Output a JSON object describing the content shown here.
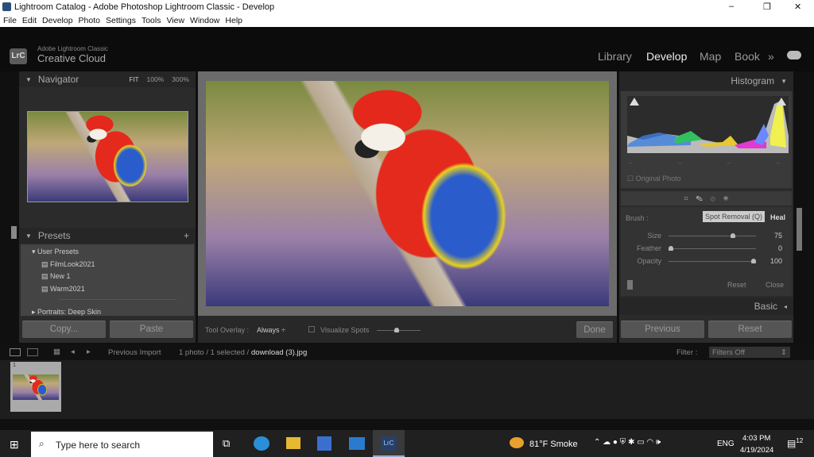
{
  "window": {
    "title": "Lightroom Catalog - Adobe Photoshop Lightroom Classic - Develop",
    "controls": [
      "–",
      "❐",
      "✕"
    ]
  },
  "menu": [
    "File",
    "Edit",
    "Develop",
    "Photo",
    "Settings",
    "Tools",
    "View",
    "Window",
    "Help"
  ],
  "brand": {
    "logo": "LrC",
    "sub": "Adobe Lightroom Classic",
    "name": "Creative Cloud"
  },
  "modules": {
    "items": [
      "Library",
      "Develop",
      "Map",
      "Book"
    ],
    "active": "Develop",
    "more": "»"
  },
  "navigator": {
    "title": "Navigator",
    "zoom": [
      "FIT",
      "100%",
      "300%"
    ]
  },
  "presets": {
    "title": "Presets",
    "add": "+",
    "group": "User Presets",
    "items": [
      "FilmLook2021",
      "New 1",
      "Warm2021"
    ],
    "next_group": "Portraits: Deep Skin"
  },
  "left_buttons": {
    "copy": "Copy...",
    "paste": "Paste"
  },
  "toolbar": {
    "overlay_label": "Tool Overlay :",
    "overlay_value": "Always",
    "visualize": "Visualize Spots",
    "visualize_checked": false,
    "done": "Done"
  },
  "histogram": {
    "title": "Histogram",
    "original_photo": "Original Photo"
  },
  "spot": {
    "brush_label": "Brush :",
    "modes": [
      "Spot Removal (Q)",
      "Heal"
    ],
    "sliders": [
      {
        "label": "Size",
        "value": "75",
        "fraction": 0.75
      },
      {
        "label": "Feather",
        "value": "0",
        "fraction": 0
      },
      {
        "label": "Opacity",
        "value": "100",
        "fraction": 1
      }
    ],
    "reset": "Reset",
    "close": "Close"
  },
  "basic": {
    "title": "Basic"
  },
  "right_buttons": {
    "previous": "Previous",
    "reset": "Reset"
  },
  "filmbar": {
    "source": "Previous Import",
    "count": "1 photo / 1 selected /",
    "file": "download (3).jpg",
    "filter_label": "Filter :",
    "filter_value": "Filters Off",
    "thumb_index": "1"
  },
  "taskbar": {
    "search_placeholder": "Type here to search",
    "weather": "81°F  Smoke",
    "lang": "ENG",
    "time": "4:03 PM",
    "date": "4/19/2024",
    "notifications": "12"
  },
  "colors": {
    "bg": "#101010",
    "panel": "#2b2b2b",
    "accent": "#ffffff"
  }
}
